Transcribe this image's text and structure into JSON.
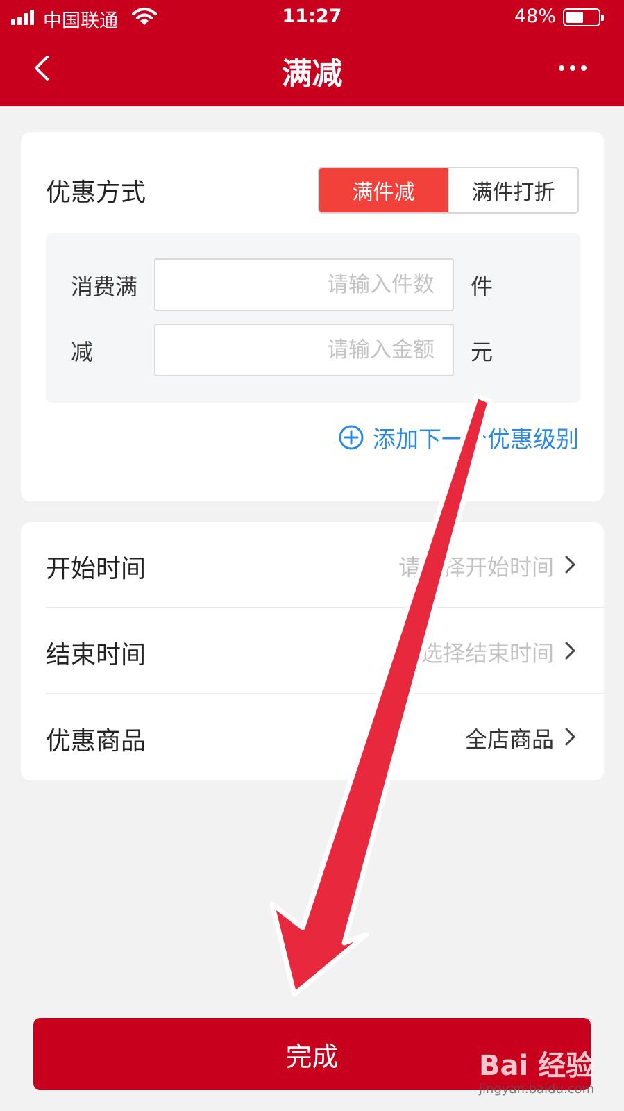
{
  "status_bar": {
    "carrier": "中国联通",
    "time": "11:27",
    "battery": "48%"
  },
  "nav": {
    "title": "满减"
  },
  "discount": {
    "label": "优惠方式",
    "options": [
      "满件减",
      "满件打折"
    ],
    "selected": "满件减"
  },
  "tier": {
    "spend_label": "消费满",
    "spend_placeholder": "请输入件数",
    "spend_unit": "件",
    "reduce_label": "减",
    "reduce_placeholder": "请输入金额",
    "reduce_unit": "元"
  },
  "add_level": "添加下一个优惠级别",
  "settings": {
    "start": {
      "label": "开始时间",
      "value": "请选择开始时间"
    },
    "end": {
      "label": "结束时间",
      "value": "请选择结束时间"
    },
    "goods": {
      "label": "优惠商品",
      "value": "全店商品"
    }
  },
  "done_button": "完成",
  "watermark": {
    "logo": "Bai 经验",
    "url": "jingyan.baidu.com"
  },
  "colors": {
    "brand_red": "#c8001e",
    "segment_active": "#f2403b",
    "link_blue": "#2b8ae0",
    "arrow_red": "#e8283c"
  }
}
